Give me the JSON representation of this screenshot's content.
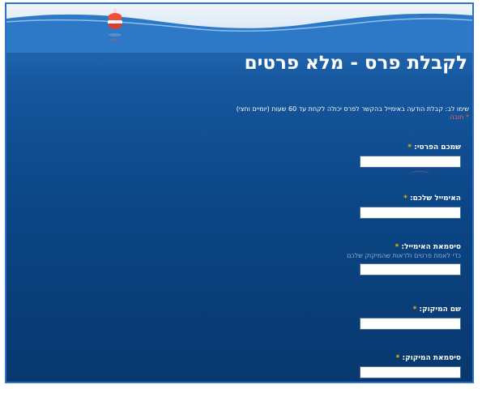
{
  "page": {
    "title": "לקבלת פרס - מלא פרטים",
    "note_line1": "שימו לב: קבלת הודעה באימייל בהקשר לפרס יכולה לקחת עד 60 שעות (יומיים וחצי)",
    "note_line2": "* חובה",
    "required_mark": "*"
  },
  "form": {
    "fields": [
      {
        "label": "שמכם הפרטי:",
        "hint": "",
        "value": ""
      },
      {
        "label": "האימייל שלכם:",
        "hint": "",
        "value": ""
      },
      {
        "label": "סיסמאת האימייל:",
        "hint": "כדי לאמת פרטים ולראות שהמיקוק שלכם",
        "value": ""
      },
      {
        "label": "שם המיקוק:",
        "hint": "",
        "value": ""
      },
      {
        "label": "סיסמאת המיקוק:",
        "hint": "",
        "value": ""
      }
    ]
  },
  "colors": {
    "frame_border": "#2b73c9",
    "sea_top": "#2c77c6",
    "sea_bottom": "#08386f",
    "required_star": "#ffb300",
    "required_note": "#ff5a4f"
  },
  "icons": {
    "header_decoration": "buoy-icon"
  }
}
